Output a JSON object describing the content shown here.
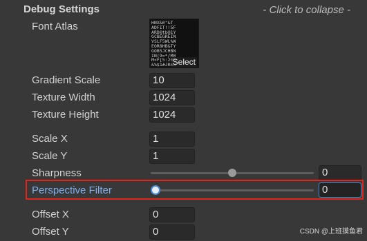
{
  "header": {
    "title": "Debug Settings",
    "collapse_hint": "- Click to collapse -"
  },
  "font_atlas": {
    "label": "Font Atlas",
    "select_label": "Select",
    "glyph_rows": [
      "HNX&0\"&T",
      "ADFIT!!5F",
      "ARD@tb@1Y",
      "GCBEGREIN",
      "VSLF5WL%W",
      "EOR8HB&TY",
      "GOB5JCHBN",
      "IN(9=*/M0",
      "M<F[5:20B",
      "&%$1#JR6B"
    ]
  },
  "fields": {
    "gradient_scale": {
      "label": "Gradient Scale",
      "value": "10"
    },
    "texture_width": {
      "label": "Texture Width",
      "value": "1024"
    },
    "texture_height": {
      "label": "Texture Height",
      "value": "1024"
    },
    "scale_x": {
      "label": "Scale X",
      "value": "1"
    },
    "scale_y": {
      "label": "Scale Y",
      "value": "1"
    },
    "sharpness": {
      "label": "Sharpness",
      "value": "0",
      "slider_fraction": 0.5
    },
    "perspective_filter": {
      "label": "Perspective Filter",
      "value": "0",
      "slider_fraction": 0.0
    },
    "offset_x": {
      "label": "Offset X",
      "value": "0"
    },
    "offset_y": {
      "label": "Offset Y",
      "value": "0"
    }
  },
  "colors": {
    "background": "#383838",
    "field_background": "#2a2a2a",
    "highlight": "#e1251b",
    "focus_accent": "#4b8bd6"
  },
  "watermark": "CSDN @上班摸鱼君"
}
